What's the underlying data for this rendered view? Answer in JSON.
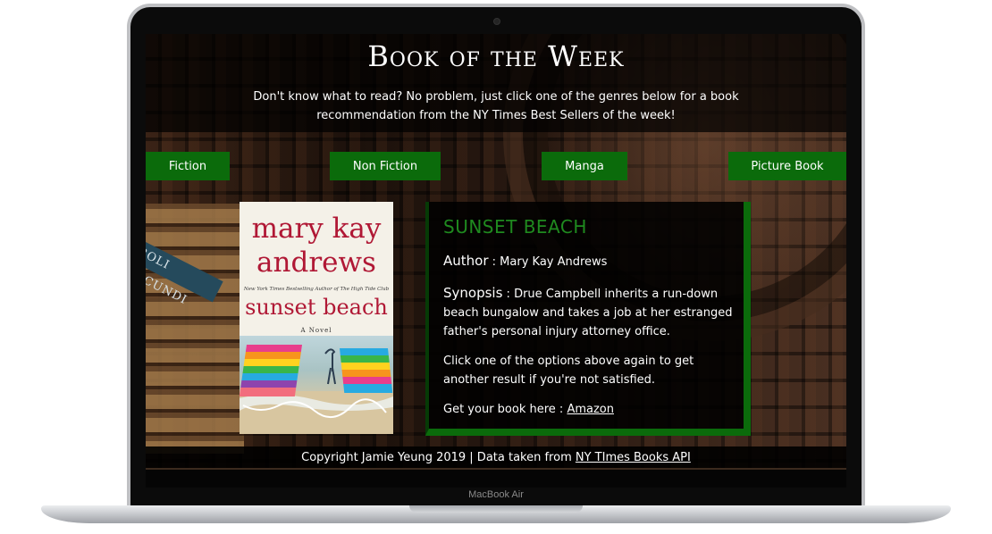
{
  "site": {
    "title": "Book of the Week",
    "intro": "Don't know what to read? No problem, just click one of the genres below for a book recommendation from the NY Times Best Sellers of the week!"
  },
  "genres": [
    {
      "label": "Fiction"
    },
    {
      "label": "Non Fiction"
    },
    {
      "label": "Manga"
    },
    {
      "label": "Picture Book"
    }
  ],
  "book": {
    "cover": {
      "author_line1": "mary kay",
      "author_line2": "andrews",
      "tagline": "New York Times Bestselling Author of The High Tide Club",
      "title": "sunset beach",
      "subtitle": "A Novel"
    },
    "title": "SUNSET BEACH",
    "author_label": "Author",
    "author": "Mary Kay Andrews",
    "synopsis_label": "Synopsis",
    "synopsis": "Drue Campbell inherits a run-down beach bungalow and takes a job at her estranged father's personal injury attorney office.",
    "hint": "Click one of the options above again to get another result if you're not satisfied.",
    "get_label": "Get your book here :",
    "link_text": "Amazon"
  },
  "footer": {
    "copyright": "Copyright Jamie Yeung 2019 | Data taken from",
    "link_text": "NY TImes Books API"
  },
  "device": {
    "model": "MacBook Air"
  },
  "colors": {
    "accent": "#0b6b0b",
    "title_green": "#1f8a1f",
    "cover_red": "#b01835"
  }
}
